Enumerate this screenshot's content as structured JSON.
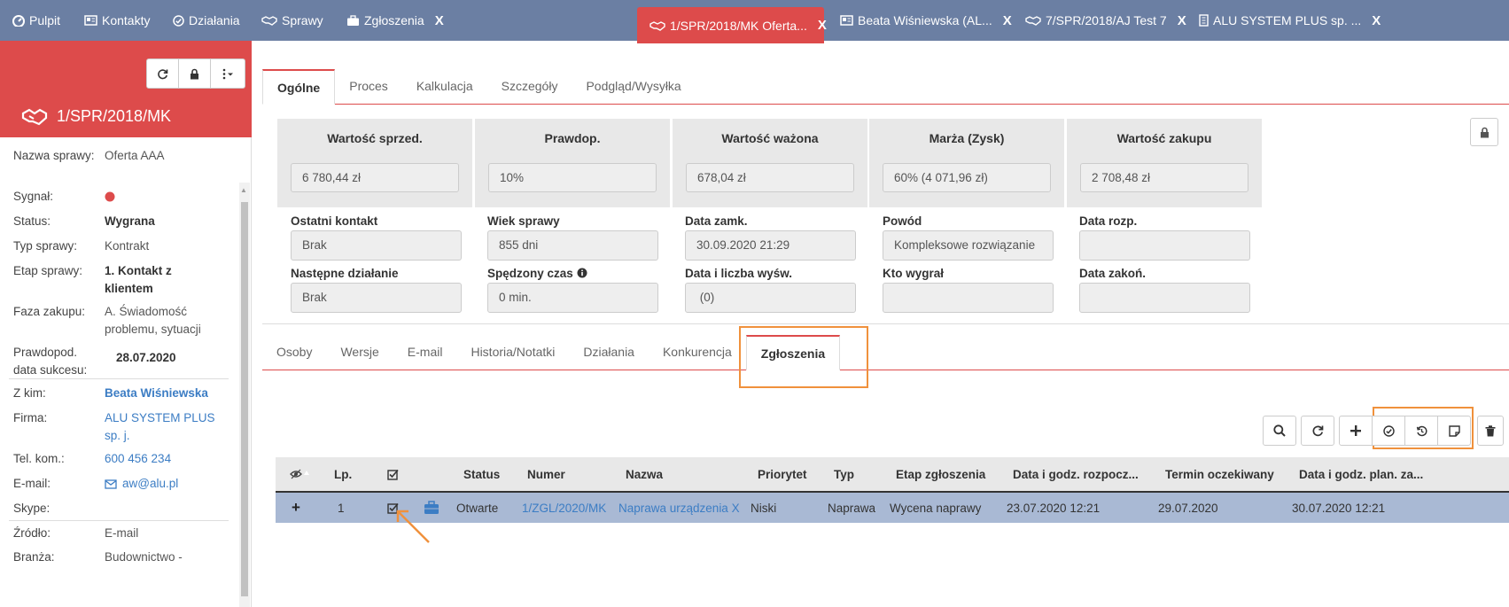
{
  "topnav": {
    "tabs": [
      {
        "label": "Pulpit",
        "icon": "dashboard-icon"
      },
      {
        "label": "Kontakty",
        "icon": "contact-card-icon"
      },
      {
        "label": "Działania",
        "icon": "check-circle-icon"
      },
      {
        "label": "Sprawy",
        "icon": "handshake-icon"
      },
      {
        "label": "Zgłoszenia",
        "icon": "briefcase-icon",
        "close": "X"
      },
      {
        "label": "1/SPR/2018/MK Oferta...",
        "icon": "handshake-icon",
        "close": "X",
        "active": true
      },
      {
        "label": "Beata Wiśniewska (AL...",
        "icon": "contact-card-icon",
        "close": "X"
      },
      {
        "label": "7/SPR/2018/AJ Test 7",
        "icon": "handshake-icon",
        "close": "X"
      },
      {
        "label": "ALU SYSTEM PLUS sp. ...",
        "icon": "building-icon",
        "close": "X"
      }
    ]
  },
  "sidebar": {
    "title": "1/SPR/2018/MK",
    "fields": {
      "name_label": "Nazwa sprawy:",
      "name_value": "Oferta AAA",
      "signal_label": "Sygnał:",
      "status_label": "Status:",
      "status_value": "Wygrana",
      "type_label": "Typ sprawy:",
      "type_value": "Kontrakt",
      "stage_label": "Etap sprawy:",
      "stage_value": "1. Kontakt z klientem",
      "phase_label": "Faza zakupu:",
      "phase_value": "A. Świadomość problemu, sytuacji",
      "probdate_label": "Prawdopod. data sukcesu:",
      "probdate_value": "28.07.2020",
      "with_label": "Z kim:",
      "with_value": "Beata Wiśniewska",
      "company_label": "Firma:",
      "company_value": "ALU SYSTEM PLUS sp. j.",
      "phone_label": "Tel. kom.:",
      "phone_value": "600 456 234",
      "email_label": "E-mail:",
      "email_value": "aw@alu.pl",
      "skype_label": "Skype:",
      "source_label": "Źródło:",
      "source_value": "E-mail",
      "industry_label": "Branża:",
      "industry_value": "Budownictwo -"
    },
    "colors": {
      "signal": "#dd4b4b"
    }
  },
  "main": {
    "tabs": [
      "Ogólne",
      "Proces",
      "Kalkulacja",
      "Szczegóły",
      "Podgląd/Wysyłka"
    ],
    "kpis": [
      {
        "label": "Wartość sprzed.",
        "value": "6 780,44 zł"
      },
      {
        "label": "Prawdop.",
        "value": "10%"
      },
      {
        "label": "Wartość ważona",
        "value": "678,04 zł"
      },
      {
        "label": "Marża (Zysk)",
        "value": "60% (4 071,96 zł)"
      },
      {
        "label": "Wartość zakupu",
        "value": "2 708,48 zł"
      }
    ],
    "fields": [
      {
        "label": "Ostatni kontakt",
        "value": "Brak"
      },
      {
        "label": "Wiek sprawy",
        "value": "855 dni"
      },
      {
        "label": "Data zamk.",
        "value": "30.09.2020 21:29"
      },
      {
        "label": "Powód",
        "value": "Kompleksowe rozwiązanie"
      },
      {
        "label": "Data rozp.",
        "value": ""
      },
      {
        "label": "Następne działanie",
        "value": "Brak"
      },
      {
        "label": "Spędzony czas",
        "value": "0 min."
      },
      {
        "label": "Data i liczba wyśw.",
        "value": " (0)"
      },
      {
        "label": "Kto wygrał",
        "value": ""
      },
      {
        "label": "Data zakoń.",
        "value": ""
      }
    ],
    "subtabs": [
      "Osoby",
      "Wersje",
      "E-mail",
      "Historia/Notatki",
      "Działania",
      "Konkurencja",
      "Zgłoszenia"
    ],
    "grid": {
      "headers": [
        "Lp.",
        "Status",
        "Numer",
        "Nazwa",
        "Priorytet",
        "Typ",
        "Etap zgłoszenia",
        "Data i godz. rozpocz...",
        "Termin oczekiwany",
        "Data i godz. plan. za..."
      ],
      "rows": [
        {
          "expand": "+",
          "lp": "1",
          "status": "Otwarte",
          "numer": "1/ZGL/2020/MK",
          "nazwa": "Naprawa urządzenia X",
          "priorytet": "Niski",
          "typ": "Naprawa",
          "etap": "Wycena naprawy",
          "start": "23.07.2020 12:21",
          "termin": "29.07.2020",
          "plan": "30.07.2020 12:21"
        }
      ]
    }
  },
  "colors": {
    "nav": "#6b7fa3",
    "accent": "#dd4b4b",
    "highlight": "#f0913c",
    "link": "#3c7dc4",
    "selected_row": "#a9b9d4"
  }
}
